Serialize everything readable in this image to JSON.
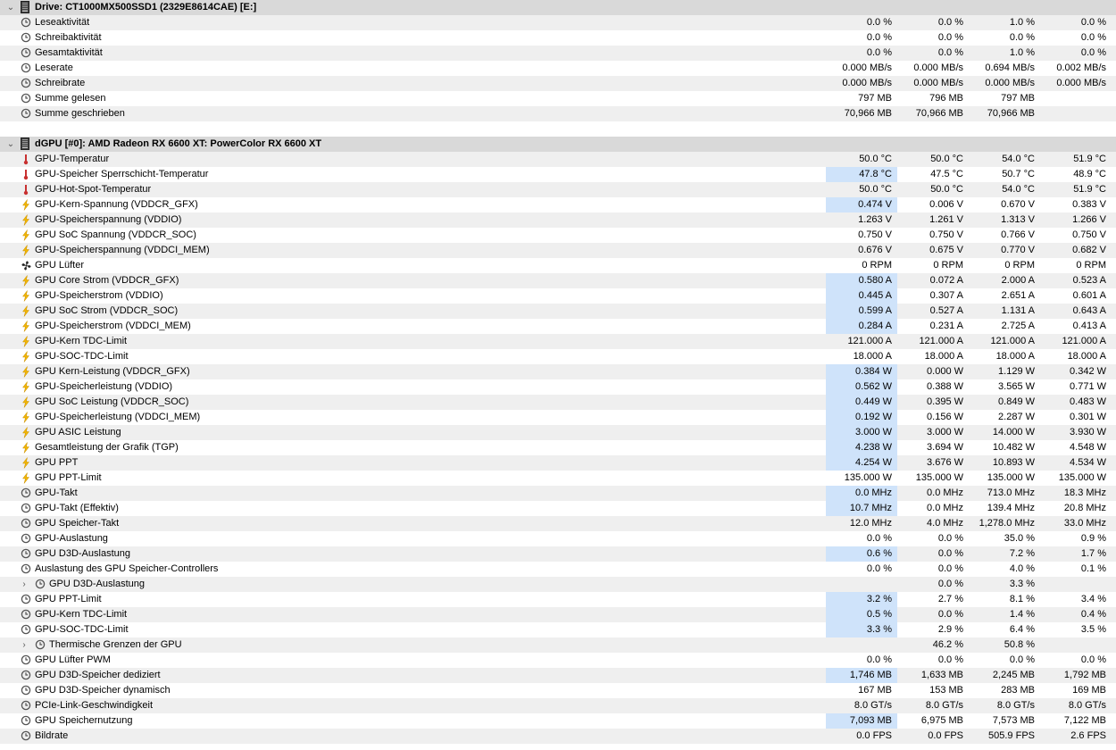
{
  "colors": {
    "highlight": "#cfe3fa",
    "group_bg": "#d9d9d9",
    "alt_row": "#efefef"
  },
  "groups": [
    {
      "title": "Drive: CT1000MX500SSD1 (2329E8614CAE) [E:]",
      "icon": "drive-icon",
      "rows": [
        {
          "icon": "clock",
          "label": "Leseaktivität",
          "values": [
            "0.0 %",
            "0.0 %",
            "1.0 %",
            "0.0 %"
          ]
        },
        {
          "icon": "clock",
          "label": "Schreibaktivität",
          "values": [
            "0.0 %",
            "0.0 %",
            "0.0 %",
            "0.0 %"
          ]
        },
        {
          "icon": "clock",
          "label": "Gesamtaktivität",
          "values": [
            "0.0 %",
            "0.0 %",
            "1.0 %",
            "0.0 %"
          ]
        },
        {
          "icon": "clock",
          "label": "Leserate",
          "values": [
            "0.000 MB/s",
            "0.000 MB/s",
            "0.694 MB/s",
            "0.002 MB/s"
          ]
        },
        {
          "icon": "clock",
          "label": "Schreibrate",
          "values": [
            "0.000 MB/s",
            "0.000 MB/s",
            "0.000 MB/s",
            "0.000 MB/s"
          ]
        },
        {
          "icon": "clock",
          "label": "Summe gelesen",
          "values": [
            "797 MB",
            "796 MB",
            "797 MB",
            ""
          ]
        },
        {
          "icon": "clock",
          "label": "Summe geschrieben",
          "values": [
            "70,966 MB",
            "70,966 MB",
            "70,966 MB",
            ""
          ]
        }
      ]
    },
    {
      "title": "dGPU [#0]: AMD Radeon RX 6600 XT: PowerColor RX 6600 XT",
      "icon": "gpu-icon",
      "rows": [
        {
          "icon": "temp",
          "label": "GPU-Temperatur",
          "values": [
            "50.0 °C",
            "50.0 °C",
            "54.0 °C",
            "51.9 °C"
          ]
        },
        {
          "icon": "temp",
          "label": "GPU-Speicher Sperrschicht-Temperatur",
          "values": [
            "47.8 °C",
            "47.5 °C",
            "50.7 °C",
            "48.9 °C"
          ],
          "hl": true
        },
        {
          "icon": "temp",
          "label": "GPU-Hot-Spot-Temperatur",
          "values": [
            "50.0 °C",
            "50.0 °C",
            "54.0 °C",
            "51.9 °C"
          ]
        },
        {
          "icon": "bolt",
          "label": "GPU-Kern-Spannung (VDDCR_GFX)",
          "values": [
            "0.474 V",
            "0.006 V",
            "0.670 V",
            "0.383 V"
          ],
          "hl": true
        },
        {
          "icon": "bolt",
          "label": "GPU-Speicherspannung (VDDIO)",
          "values": [
            "1.263 V",
            "1.261 V",
            "1.313 V",
            "1.266 V"
          ]
        },
        {
          "icon": "bolt",
          "label": "GPU SoC Spannung (VDDCR_SOC)",
          "values": [
            "0.750 V",
            "0.750 V",
            "0.766 V",
            "0.750 V"
          ]
        },
        {
          "icon": "bolt",
          "label": "GPU-Speicherspannung (VDDCI_MEM)",
          "values": [
            "0.676 V",
            "0.675 V",
            "0.770 V",
            "0.682 V"
          ]
        },
        {
          "icon": "fan",
          "label": "GPU Lüfter",
          "values": [
            "0 RPM",
            "0 RPM",
            "0 RPM",
            "0 RPM"
          ]
        },
        {
          "icon": "bolt",
          "label": "GPU Core Strom (VDDCR_GFX)",
          "values": [
            "0.580 A",
            "0.072 A",
            "2.000 A",
            "0.523 A"
          ],
          "hl": true
        },
        {
          "icon": "bolt",
          "label": "GPU-Speicherstrom (VDDIO)",
          "values": [
            "0.445 A",
            "0.307 A",
            "2.651 A",
            "0.601 A"
          ],
          "hl": true
        },
        {
          "icon": "bolt",
          "label": "GPU SoC Strom (VDDCR_SOC)",
          "values": [
            "0.599 A",
            "0.527 A",
            "1.131 A",
            "0.643 A"
          ],
          "hl": true
        },
        {
          "icon": "bolt",
          "label": "GPU-Speicherstrom (VDDCI_MEM)",
          "values": [
            "0.284 A",
            "0.231 A",
            "2.725 A",
            "0.413 A"
          ],
          "hl": true
        },
        {
          "icon": "bolt",
          "label": "GPU-Kern TDC-Limit",
          "values": [
            "121.000 A",
            "121.000 A",
            "121.000 A",
            "121.000 A"
          ]
        },
        {
          "icon": "bolt",
          "label": "GPU-SOC-TDC-Limit",
          "values": [
            "18.000 A",
            "18.000 A",
            "18.000 A",
            "18.000 A"
          ]
        },
        {
          "icon": "bolt",
          "label": "GPU Kern-Leistung (VDDCR_GFX)",
          "values": [
            "0.384 W",
            "0.000 W",
            "1.129 W",
            "0.342 W"
          ],
          "hl": true
        },
        {
          "icon": "bolt",
          "label": "GPU-Speicherleistung (VDDIO)",
          "values": [
            "0.562 W",
            "0.388 W",
            "3.565 W",
            "0.771 W"
          ],
          "hl": true
        },
        {
          "icon": "bolt",
          "label": "GPU SoC Leistung (VDDCR_SOC)",
          "values": [
            "0.449 W",
            "0.395 W",
            "0.849 W",
            "0.483 W"
          ],
          "hl": true
        },
        {
          "icon": "bolt",
          "label": "GPU-Speicherleistung (VDDCI_MEM)",
          "values": [
            "0.192 W",
            "0.156 W",
            "2.287 W",
            "0.301 W"
          ],
          "hl": true
        },
        {
          "icon": "bolt",
          "label": "GPU ASIC Leistung",
          "values": [
            "3.000 W",
            "3.000 W",
            "14.000 W",
            "3.930 W"
          ],
          "hl": true
        },
        {
          "icon": "bolt",
          "label": "Gesamtleistung der Grafik (TGP)",
          "values": [
            "4.238 W",
            "3.694 W",
            "10.482 W",
            "4.548 W"
          ],
          "hl": true
        },
        {
          "icon": "bolt",
          "label": "GPU PPT",
          "values": [
            "4.254 W",
            "3.676 W",
            "10.893 W",
            "4.534 W"
          ],
          "hl": true
        },
        {
          "icon": "bolt",
          "label": "GPU PPT-Limit",
          "values": [
            "135.000 W",
            "135.000 W",
            "135.000 W",
            "135.000 W"
          ]
        },
        {
          "icon": "clock",
          "label": "GPU-Takt",
          "values": [
            "0.0 MHz",
            "0.0 MHz",
            "713.0 MHz",
            "18.3 MHz"
          ],
          "hl": true
        },
        {
          "icon": "clock",
          "label": "GPU-Takt (Effektiv)",
          "values": [
            "10.7 MHz",
            "0.0 MHz",
            "139.4 MHz",
            "20.8 MHz"
          ],
          "hl": true
        },
        {
          "icon": "clock",
          "label": "GPU Speicher-Takt",
          "values": [
            "12.0 MHz",
            "4.0 MHz",
            "1,278.0 MHz",
            "33.0 MHz"
          ]
        },
        {
          "icon": "clock",
          "label": "GPU-Auslastung",
          "values": [
            "0.0 %",
            "0.0 %",
            "35.0 %",
            "0.9 %"
          ]
        },
        {
          "icon": "clock",
          "label": "GPU D3D-Auslastung",
          "values": [
            "0.6 %",
            "0.0 %",
            "7.2 %",
            "1.7 %"
          ],
          "hl": true
        },
        {
          "icon": "clock",
          "label": "Auslastung des GPU Speicher-Controllers",
          "values": [
            "0.0 %",
            "0.0 %",
            "4.0 %",
            "0.1 %"
          ]
        },
        {
          "icon": "clock",
          "label": "GPU D3D-Auslastung",
          "values": [
            "",
            "0.0 %",
            "3.3 %",
            ""
          ],
          "expander": true
        },
        {
          "icon": "clock",
          "label": "GPU PPT-Limit",
          "values": [
            "3.2 %",
            "2.7 %",
            "8.1 %",
            "3.4 %"
          ],
          "hl": true
        },
        {
          "icon": "clock",
          "label": "GPU-Kern TDC-Limit",
          "values": [
            "0.5 %",
            "0.0 %",
            "1.4 %",
            "0.4 %"
          ],
          "hl": true
        },
        {
          "icon": "clock",
          "label": "GPU-SOC-TDC-Limit",
          "values": [
            "3.3 %",
            "2.9 %",
            "6.4 %",
            "3.5 %"
          ],
          "hl": true
        },
        {
          "icon": "clock",
          "label": "Thermische Grenzen der GPU",
          "values": [
            "",
            "46.2 %",
            "50.8 %",
            ""
          ],
          "expander": true
        },
        {
          "icon": "clock",
          "label": "GPU Lüfter PWM",
          "values": [
            "0.0 %",
            "0.0 %",
            "0.0 %",
            "0.0 %"
          ]
        },
        {
          "icon": "clock",
          "label": "GPU D3D-Speicher dediziert",
          "values": [
            "1,746 MB",
            "1,633 MB",
            "2,245 MB",
            "1,792 MB"
          ],
          "hl": true
        },
        {
          "icon": "clock",
          "label": "GPU D3D-Speicher dynamisch",
          "values": [
            "167 MB",
            "153 MB",
            "283 MB",
            "169 MB"
          ]
        },
        {
          "icon": "clock",
          "label": "PCIe-Link-Geschwindigkeit",
          "values": [
            "8.0 GT/s",
            "8.0 GT/s",
            "8.0 GT/s",
            "8.0 GT/s"
          ]
        },
        {
          "icon": "clock",
          "label": "GPU Speichernutzung",
          "values": [
            "7,093 MB",
            "6,975 MB",
            "7,573 MB",
            "7,122 MB"
          ],
          "hl": true
        },
        {
          "icon": "clock",
          "label": "Bildrate",
          "values": [
            "0.0 FPS",
            "0.0 FPS",
            "505.9 FPS",
            "2.6 FPS"
          ]
        }
      ]
    }
  ]
}
